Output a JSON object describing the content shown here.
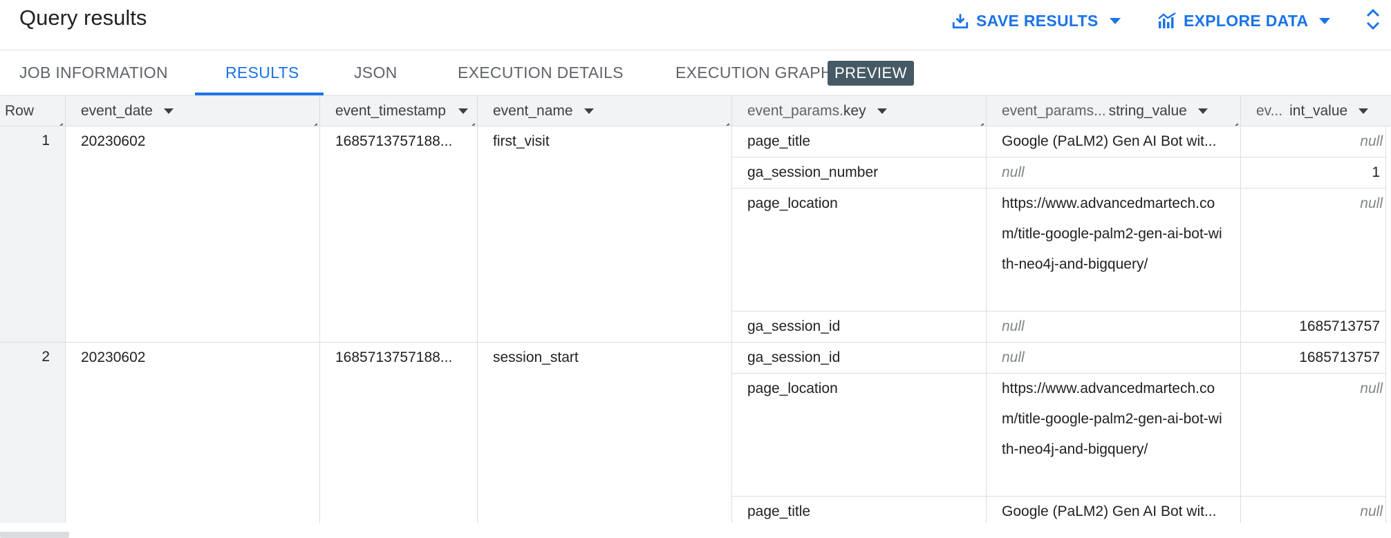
{
  "header": {
    "title": "Query results",
    "save_results": "SAVE RESULTS",
    "explore_data": "EXPLORE DATA"
  },
  "tabs": [
    {
      "label": "JOB INFORMATION"
    },
    {
      "label": "RESULTS"
    },
    {
      "label": "JSON"
    },
    {
      "label": "EXECUTION DETAILS"
    },
    {
      "label": "EXECUTION GRAPH"
    }
  ],
  "preview_badge": "PREVIEW",
  "colors": {
    "accent": "#1a73e8",
    "header_bg": "#f1f3f4",
    "badge_bg": "#455a64"
  },
  "table": {
    "columns": [
      {
        "label": "Row"
      },
      {
        "label": "event_date"
      },
      {
        "label": "event_timestamp"
      },
      {
        "label": "event_name"
      },
      {
        "prefix": "event_params.",
        "label": "key"
      },
      {
        "prefix": "event_params...",
        "label": "string_value"
      },
      {
        "prefix": "ev...",
        "label": "int_value"
      }
    ],
    "rows": [
      {
        "row": "1",
        "event_date": "20230602",
        "event_timestamp": "1685713757188...",
        "event_name": "first_visit",
        "params": [
          {
            "key": "page_title",
            "string_value": "Google (PaLM2) Gen AI Bot wit...",
            "int_value": "null"
          },
          {
            "key": "ga_session_number",
            "string_value": "null",
            "int_value": "1"
          },
          {
            "key": "page_location",
            "string_value": "https://www.advancedmartech.com/title-google-palm2-gen-ai-bot-with-neo4j-and-bigquery/",
            "int_value": "null"
          },
          {
            "key": "ga_session_id",
            "string_value": "null",
            "int_value": "1685713757"
          }
        ]
      },
      {
        "row": "2",
        "event_date": "20230602",
        "event_timestamp": "1685713757188...",
        "event_name": "session_start",
        "params": [
          {
            "key": "ga_session_id",
            "string_value": "null",
            "int_value": "1685713757"
          },
          {
            "key": "page_location",
            "string_value": "https://www.advancedmartech.com/title-google-palm2-gen-ai-bot-with-neo4j-and-bigquery/",
            "int_value": "null"
          },
          {
            "key": "page_title",
            "string_value": "Google (PaLM2) Gen AI Bot wit...",
            "int_value": "null"
          }
        ]
      }
    ]
  }
}
